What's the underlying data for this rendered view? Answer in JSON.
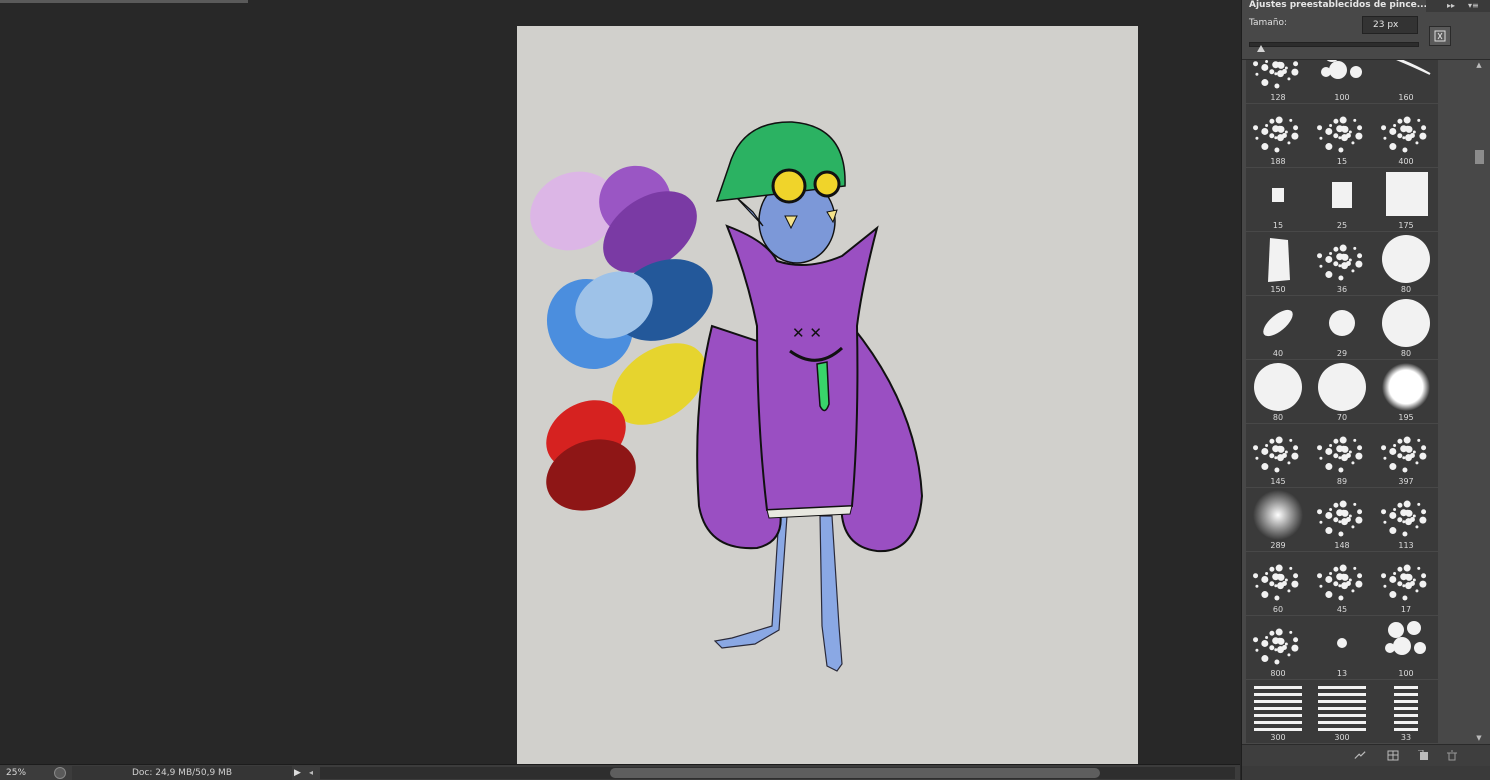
{
  "status": {
    "zoom": "25%",
    "doc_info": "Doc: 24,9 MB/50,9 MB",
    "menu_arrow": "▶",
    "scroll_left": "◂"
  },
  "panel": {
    "title": "Ajustes preestablecidos de pince...",
    "collapse_glyph": "▸▸",
    "menu_glyph": "▾≡",
    "size_label": "Tamaño:",
    "size_value": "23 px",
    "size_slider_level": 0.07,
    "brushes": [
      {
        "size": "128",
        "icon": "grass-brush-icon"
      },
      {
        "size": "100",
        "icon": "dots-cluster-brush-icon"
      },
      {
        "size": "160",
        "icon": "leaf-streak-brush-icon"
      },
      {
        "size": "188",
        "icon": "rough-patch-brush-icon"
      },
      {
        "size": "15",
        "icon": "small-splat-brush-icon"
      },
      {
        "size": "400",
        "icon": "triangle-texture-brush-icon"
      },
      {
        "size": "15",
        "icon": "chalk-small-brush-icon"
      },
      {
        "size": "25",
        "icon": "chalk-medium-brush-icon"
      },
      {
        "size": "175",
        "icon": "dry-media-brush-icon"
      },
      {
        "size": "150",
        "icon": "bristle-brush-icon"
      },
      {
        "size": "36",
        "icon": "spatter-brush-icon"
      },
      {
        "size": "80",
        "icon": "hard-round-brush-icon"
      },
      {
        "size": "40",
        "icon": "angled-ellipse-brush-icon"
      },
      {
        "size": "29",
        "icon": "hard-round-small-brush-icon"
      },
      {
        "size": "80",
        "icon": "hard-round-brush-icon"
      },
      {
        "size": "80",
        "icon": "hard-round-brush-icon"
      },
      {
        "size": "70",
        "icon": "hard-round-brush-icon"
      },
      {
        "size": "195",
        "icon": "soft-edge-round-brush-icon"
      },
      {
        "size": "145",
        "icon": "sponge-brush-icon"
      },
      {
        "size": "89",
        "icon": "scatter-leaves-brush-icon"
      },
      {
        "size": "397",
        "icon": "cloud-texture-brush-icon"
      },
      {
        "size": "289",
        "icon": "soft-round-brush-icon"
      },
      {
        "size": "148",
        "icon": "scatter-flakes-brush-icon"
      },
      {
        "size": "113",
        "icon": "scatter-flakes-brush-icon"
      },
      {
        "size": "60",
        "icon": "splatter-brush-icon"
      },
      {
        "size": "45",
        "icon": "stipple-round-brush-icon"
      },
      {
        "size": "17",
        "icon": "tiny-texture-brush-icon"
      },
      {
        "size": "800",
        "icon": "noise-texture-brush-icon"
      },
      {
        "size": "13",
        "icon": "tiny-dot-brush-icon"
      },
      {
        "size": "100",
        "icon": "dots-cluster-brush-icon"
      },
      {
        "size": "300",
        "icon": "stripes-brush-icon"
      },
      {
        "size": "300",
        "icon": "lines-brush-icon"
      },
      {
        "size": "33",
        "icon": "small-stripes-brush-icon"
      }
    ]
  },
  "colors": {
    "workspace": "#282828",
    "canvas": "#d1d0cc",
    "panel": "#484848"
  }
}
